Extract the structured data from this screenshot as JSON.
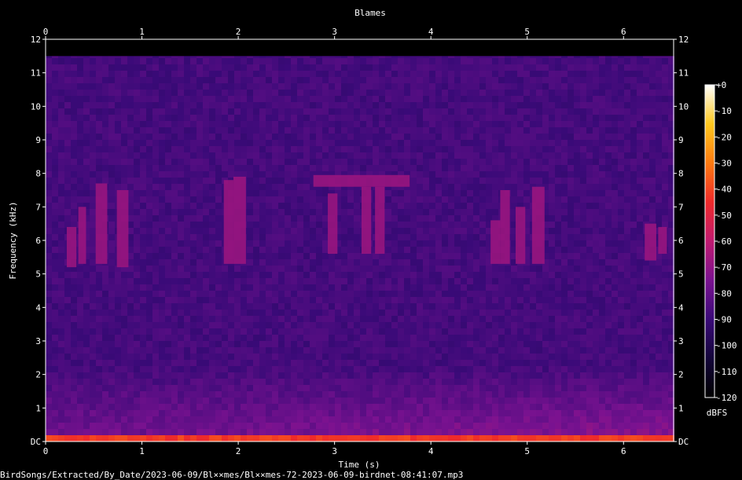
{
  "chart_data": {
    "type": "heatmap",
    "title": "Blames",
    "xlabel": "Time (s)",
    "ylabel": "Frequency (kHz)",
    "xlim": [
      0,
      6.52
    ],
    "ylim": [
      0,
      12
    ],
    "x_ticks": [
      0,
      1,
      2,
      3,
      4,
      5,
      6
    ],
    "y_ticks": [
      {
        "v": 0,
        "label": "DC"
      },
      {
        "v": 1,
        "label": "1"
      },
      {
        "v": 2,
        "label": "2"
      },
      {
        "v": 3,
        "label": "3"
      },
      {
        "v": 4,
        "label": "4"
      },
      {
        "v": 5,
        "label": "5"
      },
      {
        "v": 6,
        "label": "6"
      },
      {
        "v": 7,
        "label": "7"
      },
      {
        "v": 8,
        "label": "8"
      },
      {
        "v": 9,
        "label": "9"
      },
      {
        "v": 10,
        "label": "10"
      },
      {
        "v": 11,
        "label": "11"
      },
      {
        "v": 12,
        "label": "12"
      }
    ],
    "colorbar": {
      "unit": "dBFS",
      "range": [
        -120,
        0
      ],
      "ticks": [
        {
          "v": 0,
          "label": "+0"
        },
        {
          "v": -10,
          "label": "-10"
        },
        {
          "v": -20,
          "label": "-20"
        },
        {
          "v": -30,
          "label": "-30"
        },
        {
          "v": -40,
          "label": "-40"
        },
        {
          "v": -50,
          "label": "-50"
        },
        {
          "v": -60,
          "label": "-60"
        },
        {
          "v": -70,
          "label": "-70"
        },
        {
          "v": -80,
          "label": "-80"
        },
        {
          "v": -90,
          "label": "-90"
        },
        {
          "v": -100,
          "label": "-100"
        },
        {
          "v": -110,
          "label": "-110"
        },
        {
          "v": -120,
          "label": "-120"
        }
      ],
      "colors": [
        "#000000",
        "#14063a",
        "#3a0a78",
        "#7a1290",
        "#c01a70",
        "#ee2a2a",
        "#fd7a10",
        "#fec81e",
        "#ffffff"
      ]
    },
    "cutoff_khz": 11.5,
    "calls": [
      {
        "t0": 0.22,
        "t1": 0.32,
        "f0": 5.2,
        "f1": 6.4
      },
      {
        "t0": 0.34,
        "t1": 0.42,
        "f0": 5.3,
        "f1": 7.0
      },
      {
        "t0": 0.52,
        "t1": 0.64,
        "f0": 5.3,
        "f1": 7.7
      },
      {
        "t0": 0.74,
        "t1": 0.86,
        "f0": 5.2,
        "f1": 7.5
      },
      {
        "t0": 1.85,
        "t1": 1.95,
        "f0": 5.3,
        "f1": 7.8
      },
      {
        "t0": 1.95,
        "t1": 2.08,
        "f0": 5.3,
        "f1": 7.9
      },
      {
        "t0": 2.78,
        "t1": 3.78,
        "f0": 7.6,
        "f1": 7.95
      },
      {
        "t0": 2.93,
        "t1": 3.03,
        "f0": 5.6,
        "f1": 7.4
      },
      {
        "t0": 3.28,
        "t1": 3.38,
        "f0": 5.6,
        "f1": 7.6
      },
      {
        "t0": 3.42,
        "t1": 3.52,
        "f0": 5.6,
        "f1": 7.6
      },
      {
        "t0": 4.62,
        "t1": 4.72,
        "f0": 5.3,
        "f1": 6.6
      },
      {
        "t0": 4.72,
        "t1": 4.82,
        "f0": 5.3,
        "f1": 7.5
      },
      {
        "t0": 4.88,
        "t1": 4.98,
        "f0": 5.3,
        "f1": 7.0
      },
      {
        "t0": 5.05,
        "t1": 5.18,
        "f0": 5.3,
        "f1": 7.6
      },
      {
        "t0": 6.22,
        "t1": 6.34,
        "f0": 5.4,
        "f1": 6.5
      },
      {
        "t0": 6.36,
        "t1": 6.45,
        "f0": 5.6,
        "f1": 6.4
      }
    ]
  },
  "footer": {
    "filepath": "BirdSongs/Extracted/By_Date/2023-06-09/Bl××mes/Bl××mes-72-2023-06-09-birdnet-08:41:07.mp3"
  }
}
